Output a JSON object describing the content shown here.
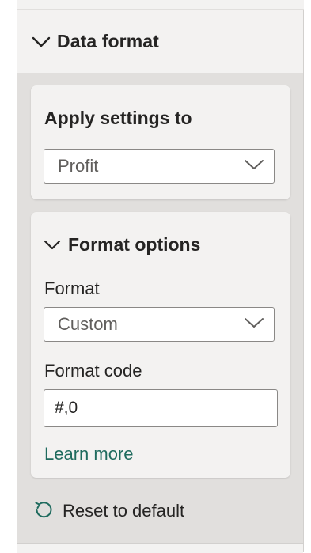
{
  "section": {
    "title": "Data format",
    "icon": "chevron-down-icon"
  },
  "apply_card": {
    "title": "Apply settings to",
    "dropdown_value": "Profit"
  },
  "format_card": {
    "title": "Format options",
    "format_label": "Format",
    "format_value": "Custom",
    "code_label": "Format code",
    "code_value": "#,0",
    "learn_more": "Learn more"
  },
  "reset": {
    "label": "Reset to default",
    "icon": "reset-icon"
  },
  "colors": {
    "accent_link": "#1f6b5e",
    "pane_bg": "#e1dfdd",
    "card_bg": "#f3f2f1"
  }
}
